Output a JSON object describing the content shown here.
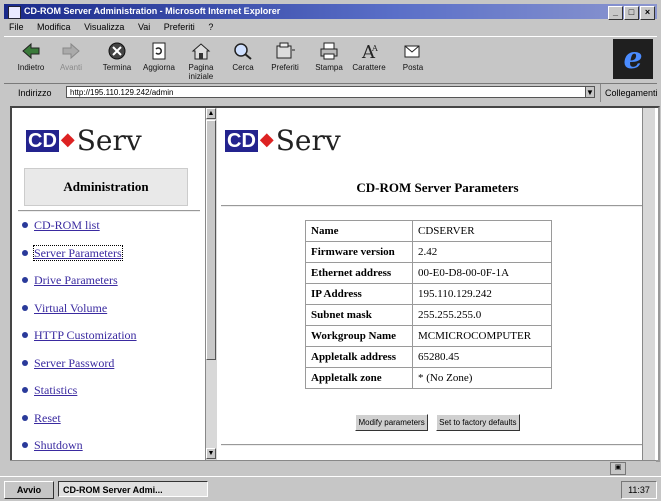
{
  "window": {
    "title": "CD-ROM Server Administration - Microsoft Internet Explorer",
    "controls": [
      "_",
      "□",
      "×"
    ]
  },
  "menubar": [
    "File",
    "Modifica",
    "Visualizza",
    "Vai",
    "Preferiti",
    "?"
  ],
  "toolbar": {
    "buttons": [
      {
        "label": "Indietro",
        "icon": "back-arrow-icon",
        "enabled": true
      },
      {
        "label": "Avanti",
        "icon": "forward-arrow-icon",
        "enabled": false
      },
      {
        "label": "Termina",
        "icon": "stop-icon",
        "enabled": true
      },
      {
        "label": "Aggiorna",
        "icon": "refresh-icon",
        "enabled": true
      },
      {
        "label": "Pagina iniziale",
        "icon": "home-icon",
        "enabled": true
      },
      {
        "label": "Cerca",
        "icon": "search-icon",
        "enabled": true
      },
      {
        "label": "Preferiti",
        "icon": "favorites-icon",
        "enabled": true
      },
      {
        "label": "Stampa",
        "icon": "print-icon",
        "enabled": true
      },
      {
        "label": "Carattere",
        "icon": "font-icon",
        "enabled": true
      },
      {
        "label": "Posta",
        "icon": "mail-icon",
        "enabled": true
      }
    ]
  },
  "address": {
    "label": "Indirizzo",
    "value": "http://195.110.129.242/admin",
    "links_label": "Collegamenti"
  },
  "left": {
    "logo_cd": "CD",
    "logo_text": "Serv",
    "section_title": "Administration",
    "nav": [
      {
        "label": "CD-ROM list"
      },
      {
        "label": "Server Parameters",
        "selected": true
      },
      {
        "label": "Drive Parameters"
      },
      {
        "label": "Virtual Volume"
      },
      {
        "label": "HTTP Customization"
      },
      {
        "label": "Server Password"
      },
      {
        "label": "Statistics"
      },
      {
        "label": "Reset"
      },
      {
        "label": "Shutdown"
      }
    ]
  },
  "right": {
    "logo_cd": "CD",
    "logo_text": "Serv",
    "page_title": "CD-ROM Server Parameters",
    "params": [
      {
        "key": "Name",
        "value": "CDSERVER"
      },
      {
        "key": "Firmware version",
        "value": "2.42"
      },
      {
        "key": "Ethernet address",
        "value": "00-E0-D8-00-0F-1A"
      },
      {
        "key": "IP Address",
        "value": "195.110.129.242"
      },
      {
        "key": "Subnet mask",
        "value": "255.255.255.0"
      },
      {
        "key": "Workgroup Name",
        "value": "MCMICROCOMPUTER"
      },
      {
        "key": "Appletalk address",
        "value": "65280.45"
      },
      {
        "key": "Appletalk zone",
        "value": "* (No Zone)"
      }
    ],
    "buttons": {
      "modify": "Modify parameters",
      "factory": "Set to factory defaults"
    }
  },
  "taskbar": {
    "start": "Avvio",
    "task": "CD-ROM Server Admi...",
    "clock": "11:37"
  }
}
